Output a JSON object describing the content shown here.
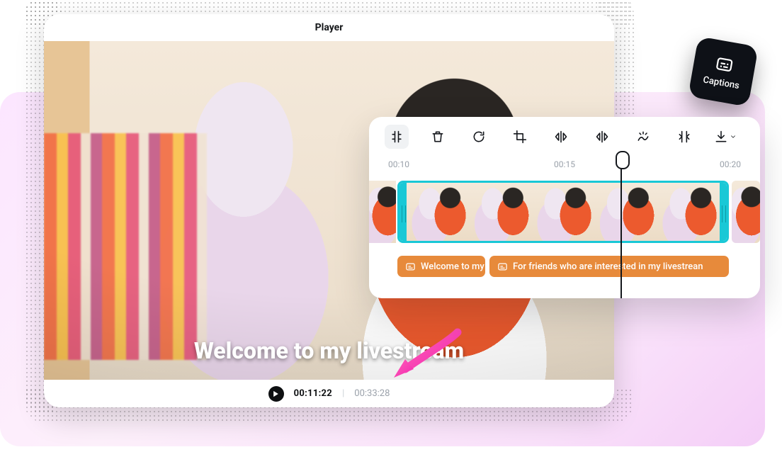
{
  "header": {
    "title": "Player",
    "layout_icon": "layout-columns-icon",
    "settings_icon": "gear-icon"
  },
  "viewport": {
    "overlay_caption": "Welcome to my livestream"
  },
  "footer": {
    "current_time": "00:11:22",
    "total_time": "00:33:28"
  },
  "captions_badge": {
    "label": "Captions"
  },
  "timeline": {
    "toolbar": {
      "tools": [
        {
          "name": "split-tool",
          "active": true
        },
        {
          "name": "delete-tool",
          "active": false
        },
        {
          "name": "rotate-tool",
          "active": false
        },
        {
          "name": "crop-tool",
          "active": false
        },
        {
          "name": "flip-horizontal-tool",
          "active": false
        },
        {
          "name": "flip-vertical-tool",
          "active": false
        },
        {
          "name": "remove-bg-tool",
          "active": false
        },
        {
          "name": "speed-tool",
          "active": false
        },
        {
          "name": "download-tool",
          "active": false
        }
      ]
    },
    "ruler": {
      "ticks": [
        "00:10",
        "00:15",
        "00:20"
      ]
    },
    "clip": {
      "thumb_count": 5
    },
    "caption_segments": [
      {
        "id": "cap1",
        "text": "Welcome to my li"
      },
      {
        "id": "cap2",
        "text": "For friends who are interested in my livestrean"
      }
    ]
  },
  "colors": {
    "accent_cyan": "#19c8d6",
    "caption_orange": "#e78a3b",
    "arrow_pink": "#f741b8"
  }
}
